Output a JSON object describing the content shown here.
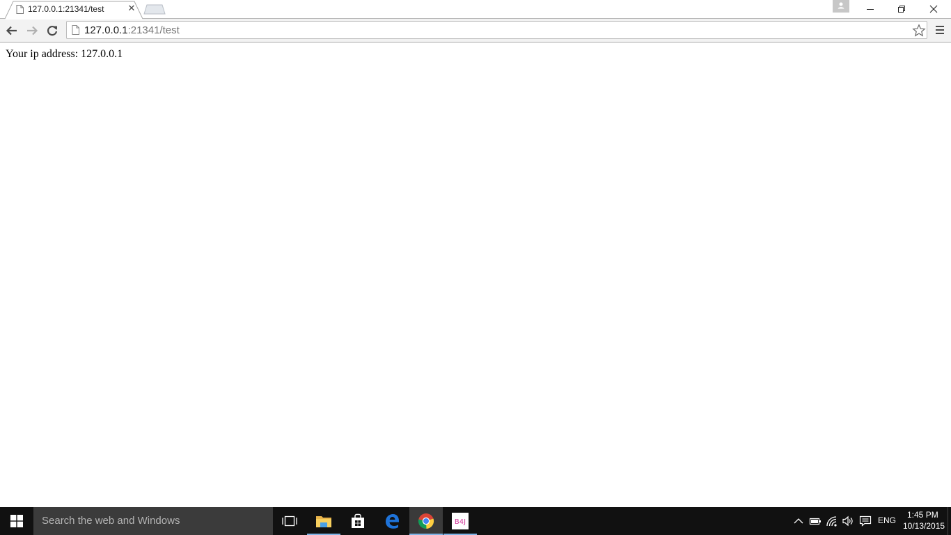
{
  "browser": {
    "tab": {
      "title": "127.0.0.1:21341/test",
      "close_glyph": "✕"
    },
    "address_bar": {
      "host": "127.0.0.1",
      "path": ":21341/test"
    }
  },
  "page": {
    "text": "Your ip address: 127.0.0.1"
  },
  "taskbar": {
    "search_placeholder": "Search the web and Windows",
    "language": "ENG",
    "time": "1:45 PM",
    "date": "10/13/2015",
    "apps": [
      "task-view",
      "file-explorer",
      "store",
      "edge",
      "chrome",
      "b4j"
    ],
    "b4j_label": "B4J"
  },
  "colors": {
    "taskbar_bg": "#111111",
    "search_bg": "#3b3b3b",
    "active_indicator": "#7fb4e6",
    "toolbar_bg": "#f2f2f2",
    "edge_blue": "#1e73d9"
  }
}
